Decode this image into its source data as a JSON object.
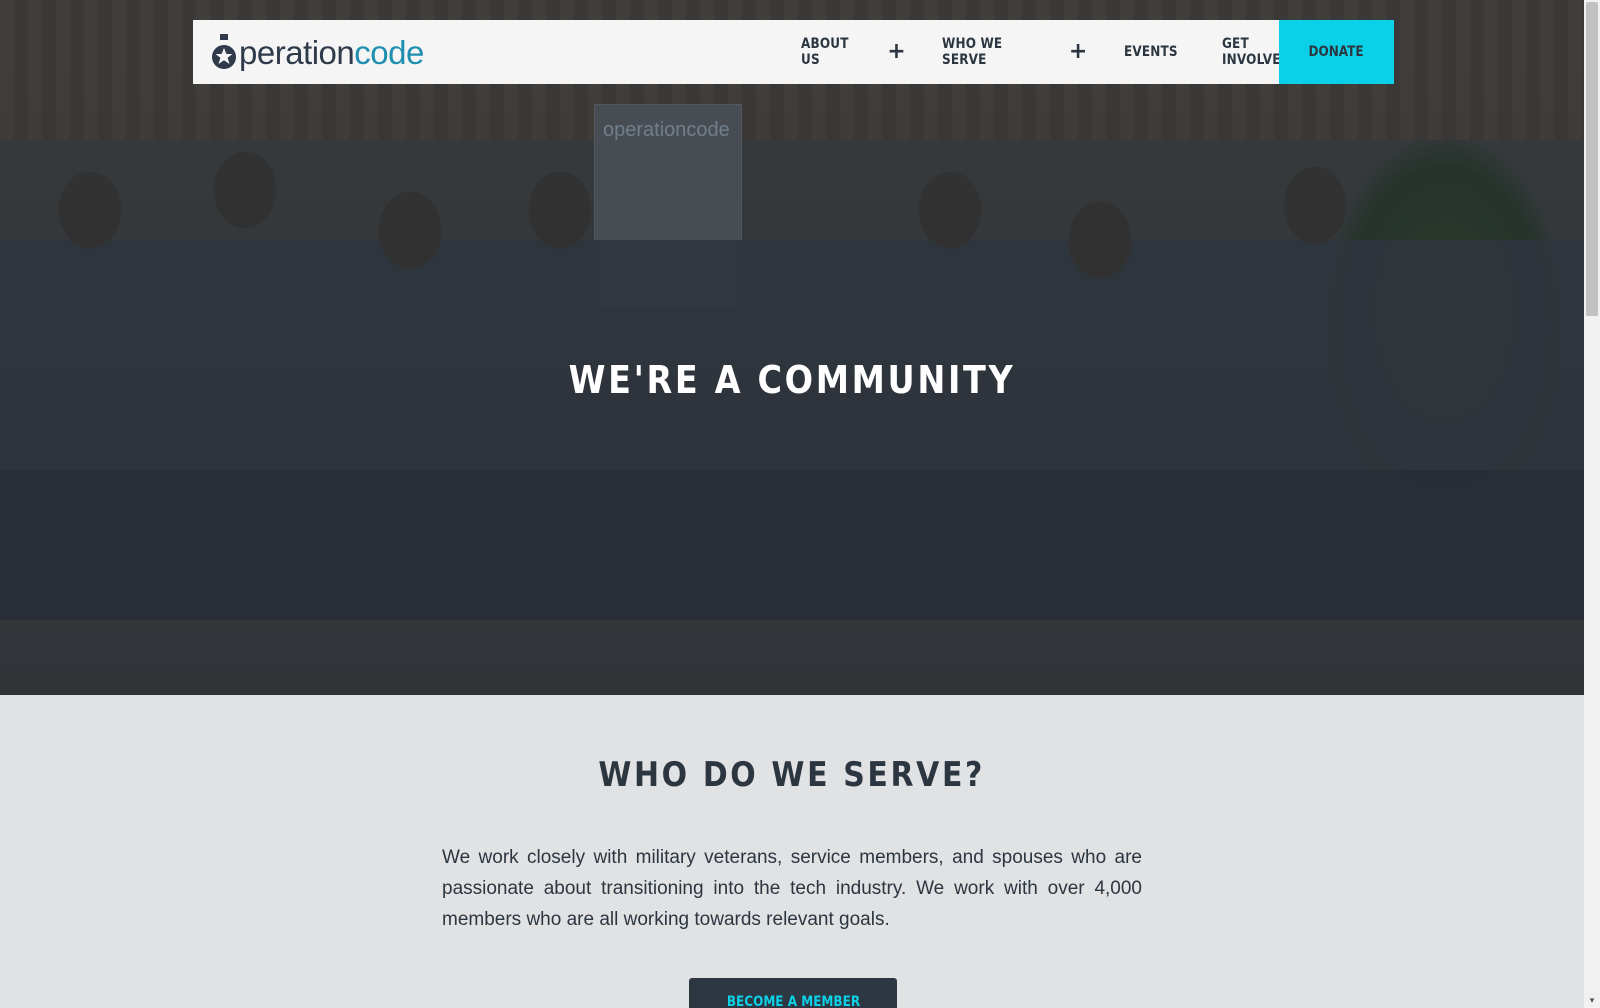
{
  "brand": {
    "logo_prefix": "peration",
    "logo_suffix": "code",
    "accent_color": "#0ad1e8",
    "logo_blue": "#1f8fb0",
    "text_color": "#2c3640"
  },
  "nav": {
    "items": [
      {
        "label": "ABOUT US",
        "has_submenu": true,
        "toggle_icon": "plus-icon"
      },
      {
        "label": "WHO WE SERVE",
        "has_submenu": true,
        "toggle_icon": "plus-icon"
      },
      {
        "label": "EVENTS",
        "has_submenu": false
      },
      {
        "label": "GET INVOLVED",
        "has_submenu": true,
        "toggle_icon": "plus-icon"
      }
    ],
    "plus_symbol": "+",
    "donate_label": "DONATE"
  },
  "hero": {
    "title": "WE'RE A COMMUNITY",
    "banner_text": "operationcode"
  },
  "serve_section": {
    "title": "WHO DO WE SERVE?",
    "body": "We work closely with military veterans, service members, and spouses who are passionate about transitioning into the tech industry. We work with over 4,000 members who are all working towards relevant goals.",
    "cta_label": "BECOME A MEMBER"
  },
  "scrollbar": {
    "down_arrow": "▾"
  }
}
